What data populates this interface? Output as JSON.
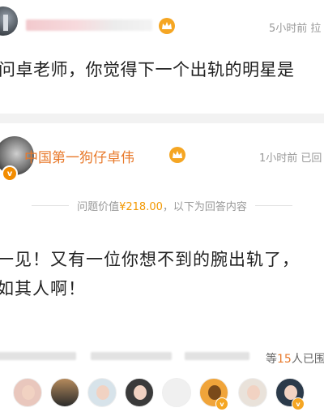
{
  "question": {
    "author_name_visible": false,
    "time": "5小时前",
    "time_suffix": "拉",
    "text": "问卓老师，你觉得下一个出轨的明星是"
  },
  "answer": {
    "author": "中国第一狗仔卓伟",
    "time": "1小时前",
    "time_suffix": "已回",
    "verified_badge": "v",
    "value_prefix": "问题价值",
    "value_amount": "¥218.00",
    "value_suffix": "，以下为回答内容",
    "lines": [
      "一见！又有一位你想不到的腕出轨了，",
      "如其人啊！"
    ]
  },
  "participants": {
    "count_prefix": "等",
    "count": "15",
    "count_suffix": "人已围",
    "vip_badge": "v"
  },
  "colors": {
    "brand_orange": "#e8792b",
    "price_orange": "#f39800",
    "badge_gold": "#f5a623",
    "muted_text": "#999999"
  }
}
